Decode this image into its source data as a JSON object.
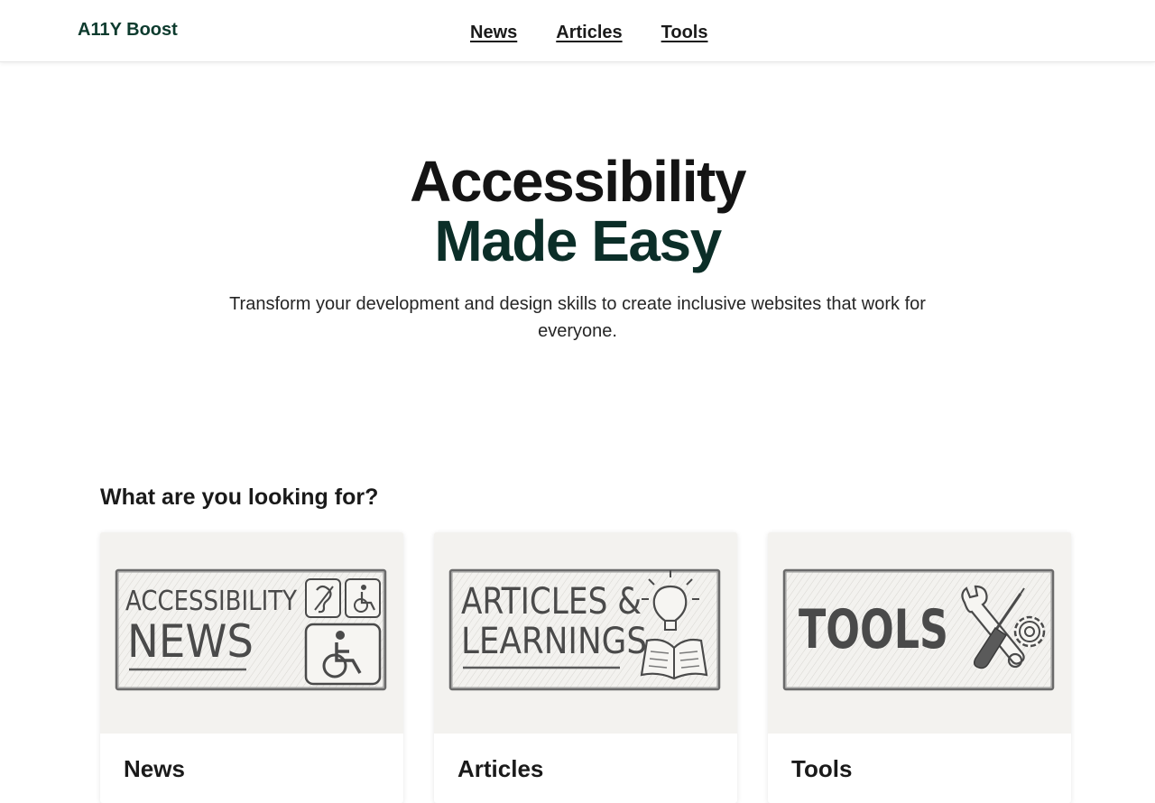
{
  "header": {
    "logo": "A11Y Boost",
    "nav": [
      {
        "label": "News"
      },
      {
        "label": "Articles"
      },
      {
        "label": "Tools"
      }
    ]
  },
  "hero": {
    "title_line1": "Accessibility",
    "title_line2": "Made Easy",
    "subtitle": "Transform your development and design skills to create inclusive websites that work for everyone."
  },
  "section": {
    "title": "What are you looking for?"
  },
  "cards": [
    {
      "title": "News",
      "image": {
        "line1": "ACCESSIBILITY",
        "line2": "NEWS",
        "icons": [
          "hearing-icon",
          "wheelchair-icon"
        ]
      }
    },
    {
      "title": "Articles",
      "image": {
        "line1": "ARTICLES &",
        "line2": "LEARNINGS",
        "icons": [
          "lightbulb-icon",
          "open-book-icon"
        ]
      }
    },
    {
      "title": "Tools",
      "image": {
        "line1": "TOOLS",
        "icons": [
          "wrench-icon",
          "screwdriver-icon",
          "gear-icon"
        ]
      }
    }
  ],
  "colors": {
    "brand_green": "#0d3b2e",
    "sketch_ink": "#4a4a4a",
    "card_image_bg": "#f3f2ef"
  }
}
